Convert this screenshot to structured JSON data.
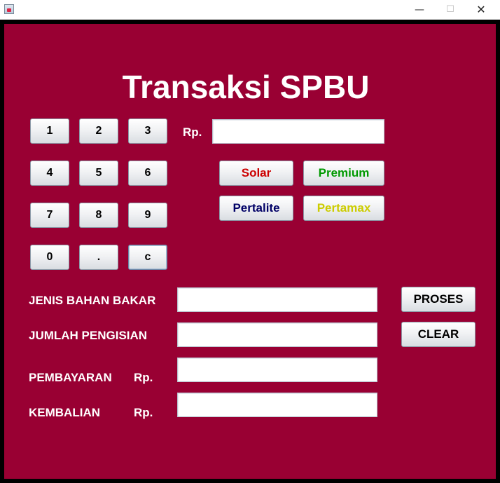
{
  "window": {
    "title": "",
    "minimize": "—",
    "maximize": "☐",
    "close": "✕"
  },
  "heading": "Transaksi SPBU",
  "keypad": [
    "1",
    "2",
    "3",
    "4",
    "5",
    "6",
    "7",
    "8",
    "9",
    "0",
    ".",
    "c"
  ],
  "amount_prefix": "Rp.",
  "amount_value": "",
  "fuel": {
    "solar": "Solar",
    "premium": "Premium",
    "pertalite": "Pertalite",
    "pertamax": "Pertamax"
  },
  "fuel_colors": {
    "solar": "#cc0000",
    "premium": "#009900",
    "pertalite": "#000066",
    "pertamax": "#cccc00"
  },
  "form": {
    "jenis_label": "JENIS BAHAN BAKAR",
    "jenis_value": "",
    "jumlah_label": "JUMLAH PENGISIAN",
    "jumlah_value": "",
    "pembayaran_label": "PEMBAYARAN",
    "pembayaran_rp": "Rp.",
    "pembayaran_value": "",
    "kembalian_label": "KEMBALIAN",
    "kembalian_rp": "Rp.",
    "kembalian_value": ""
  },
  "actions": {
    "proses": "PROSES",
    "clear": "CLEAR"
  },
  "colors": {
    "panel_bg": "#990033",
    "label_text": "#ffffff"
  }
}
